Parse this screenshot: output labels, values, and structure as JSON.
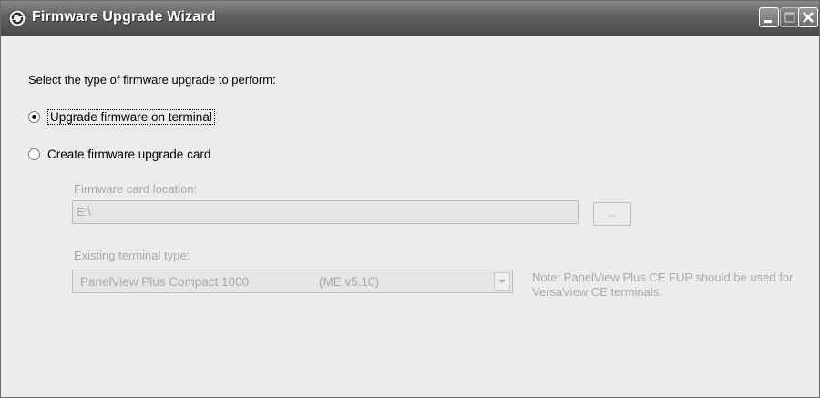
{
  "window": {
    "title": "Firmware Upgrade Wizard"
  },
  "prompt": "Select the type of firmware upgrade to perform:",
  "options": [
    {
      "label": "Upgrade firmware on terminal",
      "selected": true
    },
    {
      "label": "Create firmware upgrade card",
      "selected": false
    }
  ],
  "firmware_card": {
    "label": "Firmware card location:",
    "value": "E:\\",
    "browse_label": "..."
  },
  "terminal": {
    "label": "Existing terminal type:",
    "selected_name": "PanelView Plus Compact  1000",
    "selected_version": "(ME v5.10)"
  },
  "note": "Note: PanelView Plus CE FUP should be used for VersaView CE terminals.",
  "icons": {
    "app": "firmware-wizard-icon",
    "minimize": "minimize-icon",
    "maximize": "maximize-icon",
    "close": "close-icon",
    "dropdown": "chevron-down-icon"
  }
}
